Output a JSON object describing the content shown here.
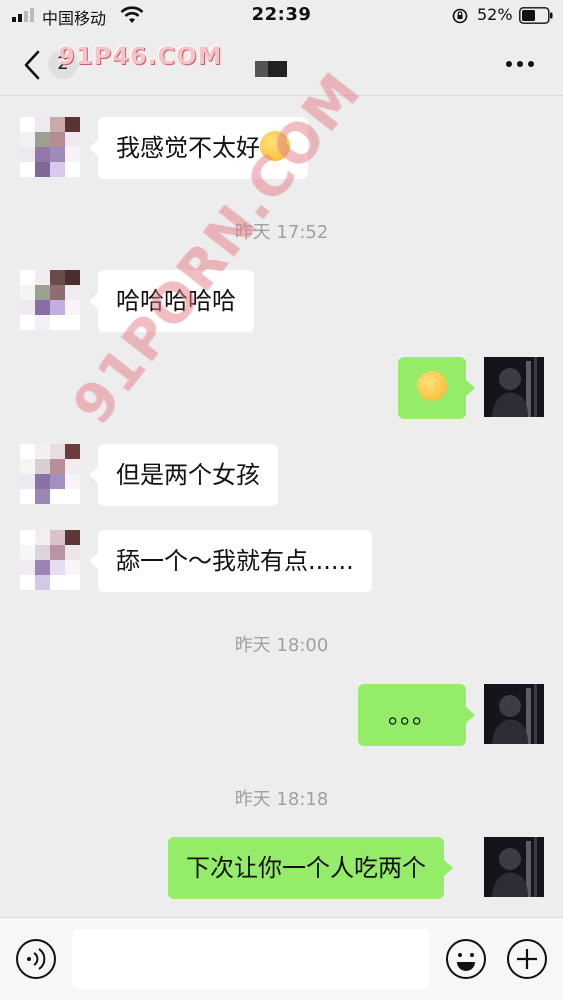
{
  "status_bar": {
    "carrier": "中国移动",
    "time": "22:39",
    "battery_percent": "52%",
    "battery_level": 0.52,
    "icons": [
      "signal-icon",
      "wifi-icon",
      "orientation-lock-icon",
      "battery-icon"
    ]
  },
  "nav": {
    "back_count": "2",
    "watermark": "91P46.COM",
    "icons": [
      "back-chevron-icon",
      "more-dots-icon"
    ]
  },
  "watermark_diagonal": "91PORN.COM",
  "messages": {
    "m1": "我感觉不太好",
    "ts1": "昨天 17:52",
    "m2": "哈哈哈哈哈",
    "m3_icon": "thinking-face-emoji",
    "m4": "但是两个女孩",
    "m5": "舔一个～我就有点......",
    "ts2": "昨天 18:00",
    "m6": "。。。",
    "ts3": "昨天 18:18",
    "m7": "下次让你一个人吃两个"
  },
  "input_bar": {
    "placeholder": "",
    "icons": [
      "voice-icon",
      "emoji-icon",
      "plus-icon"
    ]
  },
  "colors": {
    "background": "#ededed",
    "bubble_self": "#95ec69",
    "bubble_other": "#ffffff",
    "timestamp": "#a0a0a0"
  }
}
